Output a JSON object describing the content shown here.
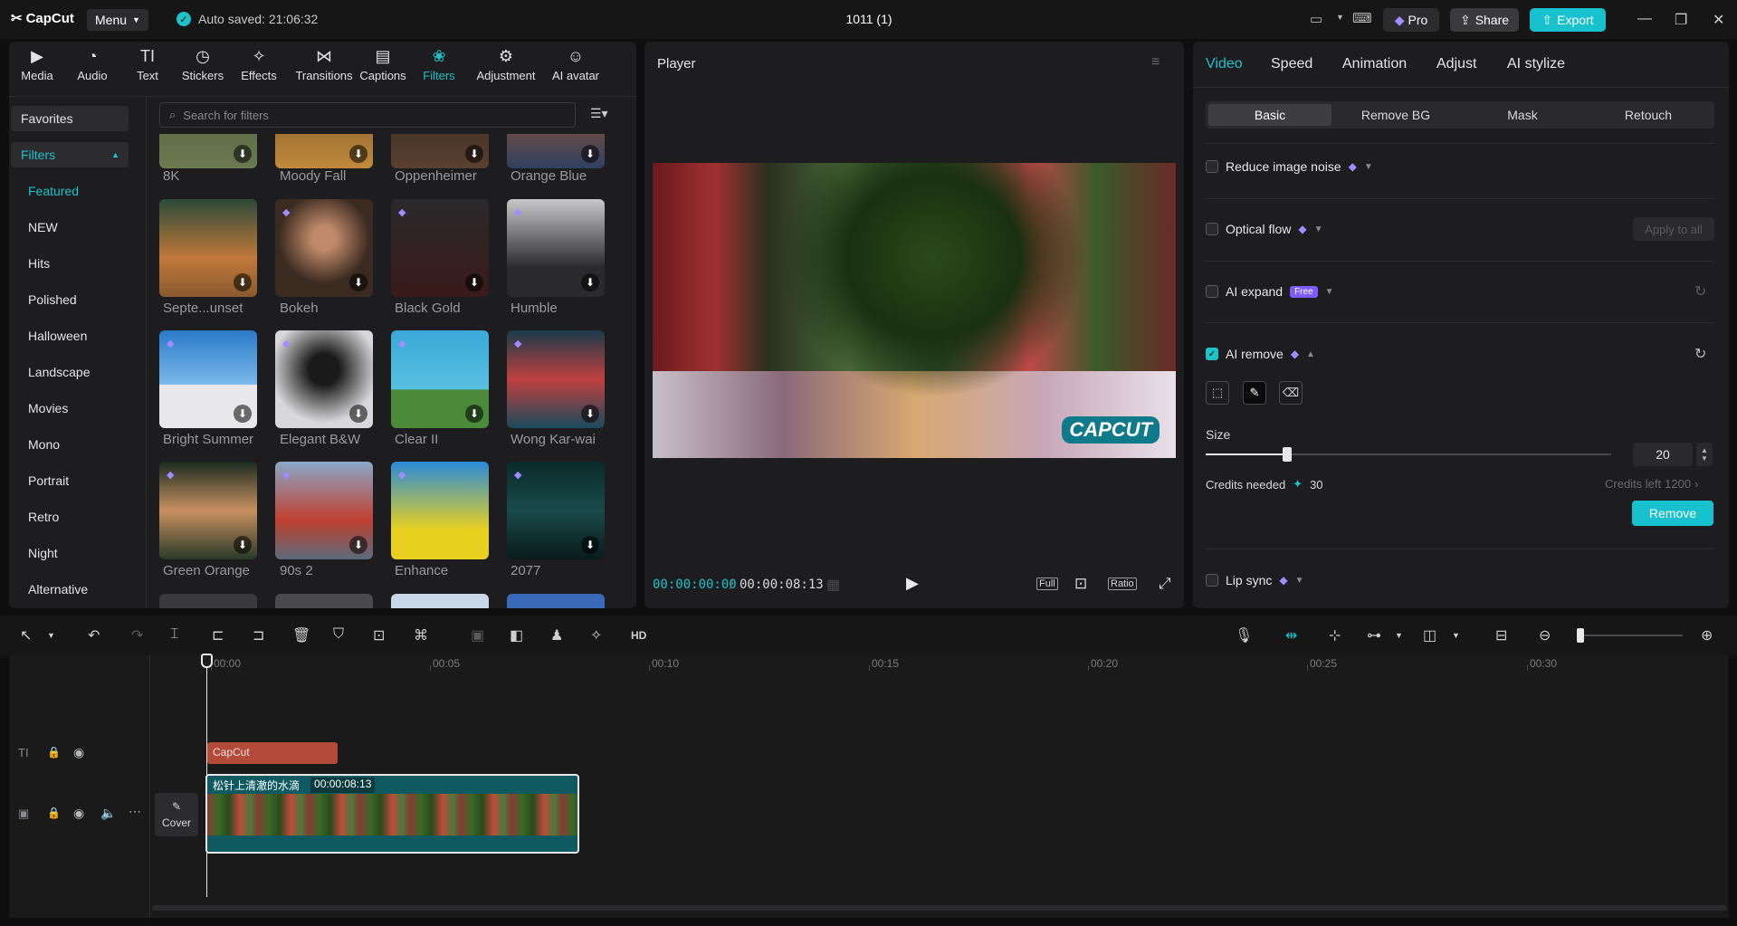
{
  "app": {
    "logo": "CapCut",
    "menu": "Menu",
    "autosave": "Auto saved: 21:06:32",
    "project": "1011 (1)",
    "pro": "Pro",
    "share": "Share",
    "export": "Export"
  },
  "toolbar": {
    "items": [
      {
        "label": "Media",
        "icon": "media-icon"
      },
      {
        "label": "Audio",
        "icon": "audio-icon"
      },
      {
        "label": "Text",
        "icon": "text-icon"
      },
      {
        "label": "Stickers",
        "icon": "stickers-icon"
      },
      {
        "label": "Effects",
        "icon": "effects-icon"
      },
      {
        "label": "Transitions",
        "icon": "transitions-icon"
      },
      {
        "label": "Captions",
        "icon": "captions-icon"
      },
      {
        "label": "Filters",
        "icon": "filters-icon"
      },
      {
        "label": "Adjustment",
        "icon": "adjustment-icon"
      },
      {
        "label": "AI avatar",
        "icon": "ai-avatar-icon"
      }
    ],
    "active": "Filters"
  },
  "sidebar": {
    "favorites": "Favorites",
    "filters": "Filters",
    "items": [
      "Featured",
      "NEW",
      "Hits",
      "Polished",
      "Halloween",
      "Landscape",
      "Movies",
      "Mono",
      "Portrait",
      "Retro",
      "Night",
      "Alternative"
    ],
    "selected": "Featured"
  },
  "search": {
    "placeholder": "Search for filters"
  },
  "filters": {
    "row0": [
      "8K",
      "Moody Fall",
      "Oppenheimer",
      "Orange Blue"
    ],
    "row1": [
      "Septe...unset",
      "Bokeh",
      "Black Gold",
      "Humble"
    ],
    "row2": [
      "Bright Summer",
      "Elegant B&W",
      "Clear II",
      "Wong Kar-wai"
    ],
    "row3": [
      "Green Orange",
      "90s 2",
      "Enhance",
      "2077"
    ]
  },
  "player": {
    "title": "Player",
    "current_time": "00:00:00:00",
    "total_time": "00:00:08:13",
    "full": "Full",
    "ratio": "Ratio",
    "watermark": "CAPCUT"
  },
  "right": {
    "tabs": [
      "Video",
      "Speed",
      "Animation",
      "Adjust",
      "AI stylize"
    ],
    "selected_tab": "Video",
    "seg": [
      "Basic",
      "Remove BG",
      "Mask",
      "Retouch"
    ],
    "selected_seg": "Basic",
    "reduce_noise": "Reduce image noise",
    "optical_flow": "Optical flow",
    "apply_all": "Apply to all",
    "ai_expand": "AI expand",
    "free": "Free",
    "ai_remove": "AI remove",
    "size_label": "Size",
    "size_value": "20",
    "size_fraction": 0.2,
    "credits_needed": "Credits needed",
    "credits_value": "30",
    "credits_left": "Credits left",
    "credits_left_value": "1200",
    "remove": "Remove",
    "lip_sync": "Lip sync"
  },
  "timeline": {
    "ruler": [
      "00:00",
      "00:05",
      "00:10",
      "00:15",
      "00:20",
      "00:25",
      "00:30"
    ],
    "text_clip": "CapCut",
    "video_clip_name": "松针上清澈的水滴",
    "video_clip_dur": "00:00:08:13",
    "cover": "Cover"
  },
  "colors": {
    "accent": "#1ec2c9",
    "panel": "#1d1d1f",
    "gem": "#a28cff"
  }
}
